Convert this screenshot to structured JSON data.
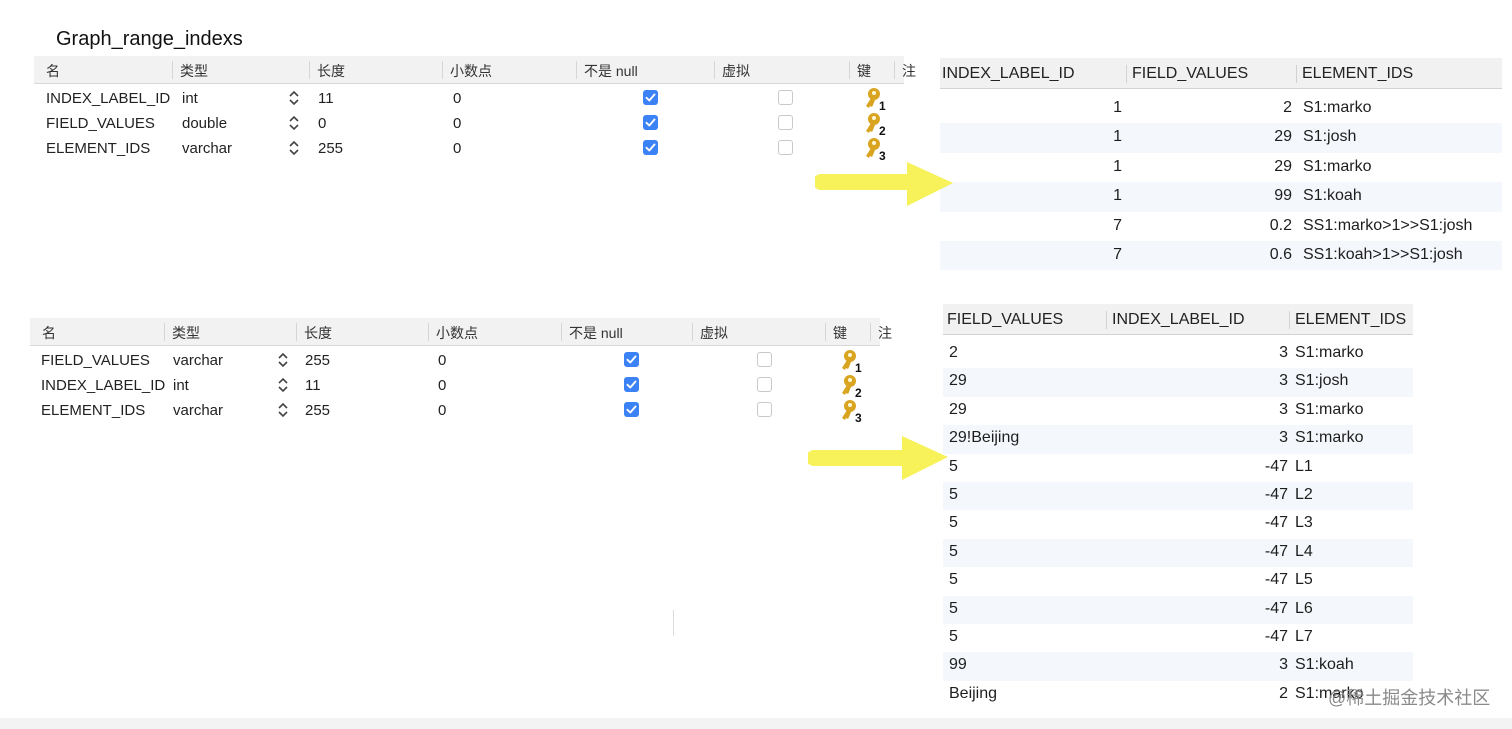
{
  "title": "Graph_range_indexs",
  "schema_headers": [
    "名",
    "类型",
    "长度",
    "小数点",
    "不是 null",
    "虚拟",
    "键",
    "注"
  ],
  "schema1": {
    "rows": [
      {
        "name": "INDEX_LABEL_ID",
        "type": "int",
        "length": "11",
        "decimal": "0",
        "not_null": true,
        "virtual": false,
        "key": "1"
      },
      {
        "name": "FIELD_VALUES",
        "type": "double",
        "length": "0",
        "decimal": "0",
        "not_null": true,
        "virtual": false,
        "key": "2"
      },
      {
        "name": "ELEMENT_IDS",
        "type": "varchar",
        "length": "255",
        "decimal": "0",
        "not_null": true,
        "virtual": false,
        "key": "3"
      }
    ]
  },
  "schema2": {
    "rows": [
      {
        "name": "FIELD_VALUES",
        "type": "varchar",
        "length": "255",
        "decimal": "0",
        "not_null": true,
        "virtual": false,
        "key": "1"
      },
      {
        "name": "INDEX_LABEL_ID",
        "type": "int",
        "length": "11",
        "decimal": "0",
        "not_null": true,
        "virtual": false,
        "key": "2"
      },
      {
        "name": "ELEMENT_IDS",
        "type": "varchar",
        "length": "255",
        "decimal": "0",
        "not_null": true,
        "virtual": false,
        "key": "3"
      }
    ]
  },
  "grid1": {
    "headers": [
      "INDEX_LABEL_ID",
      "FIELD_VALUES",
      "ELEMENT_IDS"
    ],
    "rows": [
      [
        "1",
        "2",
        "S1:marko"
      ],
      [
        "1",
        "29",
        "S1:josh"
      ],
      [
        "1",
        "29",
        "S1:marko"
      ],
      [
        "1",
        "99",
        "S1:koah"
      ],
      [
        "7",
        "0.2",
        "SS1:marko>1>>S1:josh"
      ],
      [
        "7",
        "0.6",
        "SS1:koah>1>>S1:josh"
      ]
    ]
  },
  "grid2": {
    "headers": [
      "FIELD_VALUES",
      "INDEX_LABEL_ID",
      "ELEMENT_IDS"
    ],
    "rows": [
      [
        "2",
        "3",
        "S1:marko"
      ],
      [
        "29",
        "3",
        "S1:josh"
      ],
      [
        "29",
        "3",
        "S1:marko"
      ],
      [
        "29!Beijing",
        "3",
        "S1:marko"
      ],
      [
        "5",
        "-47",
        "L1"
      ],
      [
        "5",
        "-47",
        "L2"
      ],
      [
        "5",
        "-47",
        "L3"
      ],
      [
        "5",
        "-47",
        "L4"
      ],
      [
        "5",
        "-47",
        "L5"
      ],
      [
        "5",
        "-47",
        "L6"
      ],
      [
        "5",
        "-47",
        "L7"
      ],
      [
        "99",
        "3",
        "S1:koah"
      ],
      [
        "Beijing",
        "2",
        "S1:marko"
      ]
    ]
  },
  "watermark": "@稀土掘金技术社区",
  "colors": {
    "arrow": "#f7f25a",
    "checkbox": "#3b82f6",
    "key": "#d9a521",
    "row_alt": "#f4f7fb"
  }
}
